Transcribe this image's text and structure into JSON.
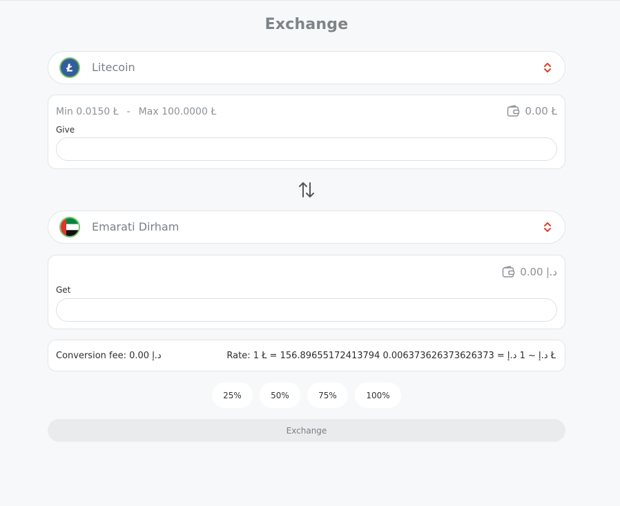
{
  "header": {
    "title": "Exchange"
  },
  "give": {
    "currency": "Litecoin",
    "min": "Min 0.0150 Ł",
    "separator": "-",
    "max": "Max 100.0000 Ł",
    "balance": "0.00 Ł",
    "label": "Give",
    "value": "",
    "placeholder": ""
  },
  "get": {
    "currency": "Emarati Dirham",
    "balance": "0.00 د.إ",
    "label": "Get",
    "value": "",
    "placeholder": ""
  },
  "info": {
    "fee": "Conversion fee: 0.00 د.إ",
    "rate": "Rate: 1 Ł = 156.89655172413794 د.إ ~ 1 د.إ = 0.006373626373626373 Ł"
  },
  "percent_buttons": [
    "25%",
    "50%",
    "75%",
    "100%"
  ],
  "exchange_button": "Exchange",
  "icons": {
    "give_coin": "litecoin-icon",
    "get_coin": "uae-flag-icon",
    "select": "chevron-up-down-icon",
    "wallet": "wallet-icon",
    "swap": "swap-arrows-icon"
  },
  "colors": {
    "chevron": "#e03b24",
    "litecoin": "#345d9d",
    "coin_ring": "#7cc46a"
  }
}
